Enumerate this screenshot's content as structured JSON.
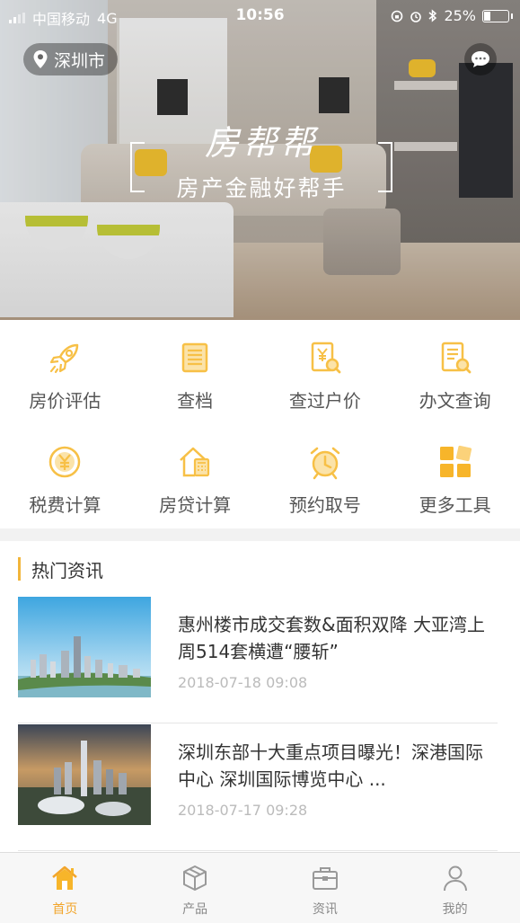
{
  "status": {
    "carrier": "中国移动",
    "network": "4G",
    "time": "10:56",
    "battery": "25%",
    "battery_level": 0.25
  },
  "header": {
    "city": "深圳市",
    "brand_script": "房帮帮",
    "tagline": "房产金融好帮手"
  },
  "tools": [
    {
      "label": "房价评估",
      "icon": "rocket-icon"
    },
    {
      "label": "查档",
      "icon": "document-icon"
    },
    {
      "label": "查过户价",
      "icon": "price-search-icon"
    },
    {
      "label": "办文查询",
      "icon": "file-search-icon"
    },
    {
      "label": "税费计算",
      "icon": "yen-coin-icon"
    },
    {
      "label": "房贷计算",
      "icon": "house-calculator-icon"
    },
    {
      "label": "预约取号",
      "icon": "alarm-clock-icon"
    },
    {
      "label": "更多工具",
      "icon": "grid-icon"
    }
  ],
  "news": {
    "section_title": "热门资讯",
    "items": [
      {
        "title": "惠州楼市成交套数&面积双降 大亚湾上周514套横遭“腰斩”",
        "date": "2018-07-18 09:08"
      },
      {
        "title": "深圳东部十大重点项目曝光！深港国际中心 深圳国际博览中心 ...",
        "date": "2018-07-17 09:28"
      }
    ]
  },
  "tabs": [
    {
      "label": "首页",
      "icon": "home-icon",
      "active": true
    },
    {
      "label": "产品",
      "icon": "box-icon",
      "active": false
    },
    {
      "label": "资讯",
      "icon": "briefcase-icon",
      "active": false
    },
    {
      "label": "我的",
      "icon": "user-icon",
      "active": false
    }
  ],
  "colors": {
    "accent": "#f2a52b",
    "icon_yellow": "#f7c046"
  }
}
